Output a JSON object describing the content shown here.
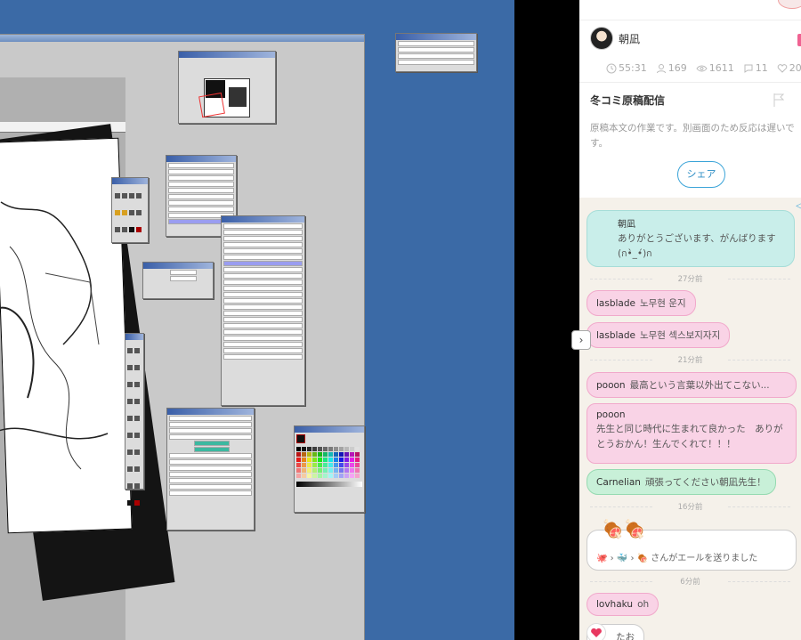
{
  "stream": {
    "username": "朝凪",
    "stats": {
      "duration": "55:31",
      "viewers": "169",
      "total_views": "1611",
      "comments": "11",
      "likes": "20"
    },
    "title": "冬コミ原稿配信",
    "description": "原稿本文の作業です。別画面のため反応は遅いです。",
    "share_label": "シェア"
  },
  "chat": [
    {
      "type": "streamer",
      "author": "朝凪",
      "text": "ありがとうございます、がんばります(ก•̀_•́)ก"
    },
    {
      "type": "time",
      "text": "27分前"
    },
    {
      "type": "pink",
      "author": "lasblade",
      "text": "노무현 운지"
    },
    {
      "type": "pink",
      "author": "lasblade",
      "text": "노무현 섹스보지자지"
    },
    {
      "type": "time",
      "text": "21分前"
    },
    {
      "type": "pink",
      "author": "pooon",
      "text": "最高という言葉以外出てこない..."
    },
    {
      "type": "pink-block",
      "author": "pooon",
      "text": "先生と同じ時代に生まれて良かった　ありがとうおかん！生んでくれて！！！"
    },
    {
      "type": "green",
      "author": "Carnelian",
      "text": "頑張ってください朝凪先生！"
    },
    {
      "type": "time",
      "text": "16分前"
    },
    {
      "type": "yell",
      "text": "さんがエールを送りました"
    },
    {
      "type": "time",
      "text": "6分前"
    },
    {
      "type": "pink",
      "author": "lovhaku",
      "text": "oh"
    },
    {
      "type": "partial",
      "text": "たお"
    }
  ],
  "colors": {
    "desktop": "#3b6aa6",
    "share": "#3ba4d8",
    "pink": "#f9d3e6",
    "green": "#c8f0d8",
    "teal": "#c9eeea",
    "chat_bg": "#f5f1ea"
  },
  "icons": [
    "clock-icon",
    "person-icon",
    "eye-icon",
    "comment-icon",
    "heart-icon",
    "flag-icon",
    "share-icon",
    "chevron-right-icon"
  ]
}
